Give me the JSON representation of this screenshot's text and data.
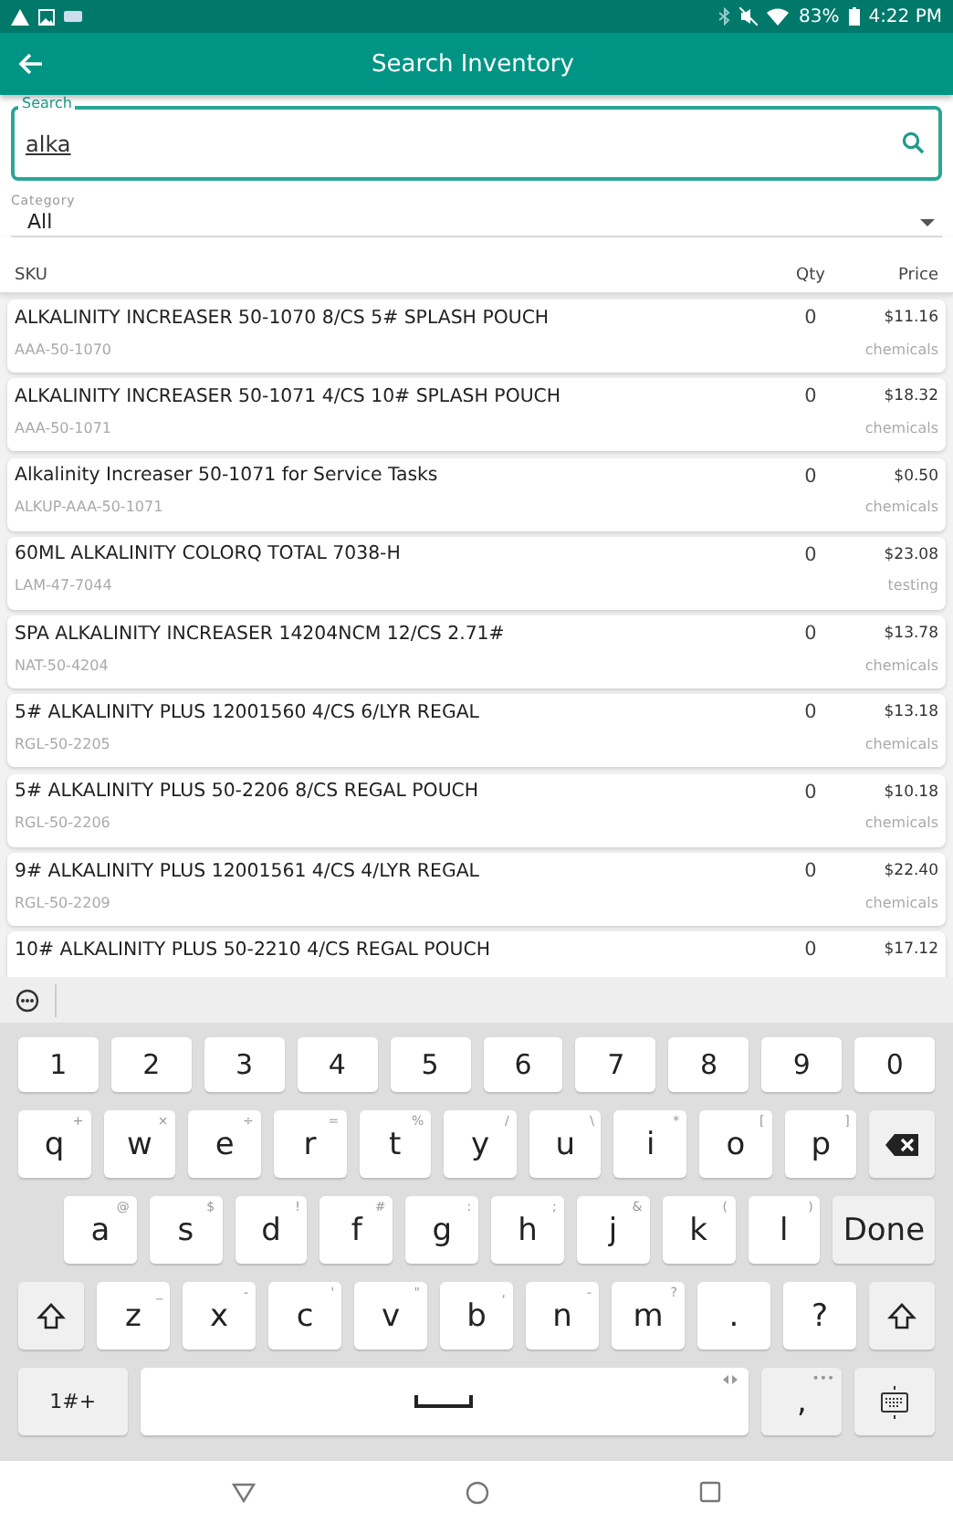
{
  "status_bar": {
    "battery": "83%",
    "time": "4:22 PM"
  },
  "app_bar": {
    "title": "Search Inventory"
  },
  "search": {
    "label": "Search",
    "value": "alka"
  },
  "category": {
    "label": "Category",
    "value": "All"
  },
  "table": {
    "columns": [
      "SKU",
      "Qty",
      "Price"
    ],
    "rows": [
      {
        "name": "ALKALINITY INCREASER 50-1070 8/CS 5# SPLASH POUCH",
        "sku": "AAA-50-1070",
        "qty": "0",
        "price": "$11.16",
        "category": "chemicals"
      },
      {
        "name": "ALKALINITY INCREASER 50-1071 4/CS 10# SPLASH POUCH",
        "sku": "AAA-50-1071",
        "qty": "0",
        "price": "$18.32",
        "category": "chemicals"
      },
      {
        "name": "Alkalinity Increaser 50-1071 for Service Tasks",
        "sku": "ALKUP-AAA-50-1071",
        "qty": "0",
        "price": "$0.50",
        "category": "chemicals"
      },
      {
        "name": "60ML ALKALINITY COLORQ TOTAL 7038-H",
        "sku": "LAM-47-7044",
        "qty": "0",
        "price": "$23.08",
        "category": "testing"
      },
      {
        "name": "SPA ALKALINITY INCREASER 14204NCM 12/CS 2.71#",
        "sku": "NAT-50-4204",
        "qty": "0",
        "price": "$13.78",
        "category": "chemicals"
      },
      {
        "name": "5# ALKALINITY PLUS 12001560 4/CS 6/LYR REGAL",
        "sku": "RGL-50-2205",
        "qty": "0",
        "price": "$13.18",
        "category": "chemicals"
      },
      {
        "name": "5# ALKALINITY PLUS 50-2206 8/CS REGAL POUCH",
        "sku": "RGL-50-2206",
        "qty": "0",
        "price": "$10.18",
        "category": "chemicals"
      },
      {
        "name": "9# ALKALINITY PLUS 12001561 4/CS 4/LYR REGAL",
        "sku": "RGL-50-2209",
        "qty": "0",
        "price": "$22.40",
        "category": "chemicals"
      },
      {
        "name": "10# ALKALINITY PLUS 50-2210 4/CS REGAL POUCH",
        "qty": "0",
        "price": "$17.12"
      }
    ]
  },
  "keyboard": {
    "rows": [
      {
        "kind": "numbers",
        "keys": [
          {
            "kind": "char",
            "label": "1"
          },
          {
            "kind": "char",
            "label": "2"
          },
          {
            "kind": "char",
            "label": "3"
          },
          {
            "kind": "char",
            "label": "4"
          },
          {
            "kind": "char",
            "label": "5"
          },
          {
            "kind": "char",
            "label": "6"
          },
          {
            "kind": "char",
            "label": "7"
          },
          {
            "kind": "char",
            "label": "8"
          },
          {
            "kind": "char",
            "label": "9"
          },
          {
            "kind": "char",
            "label": "0"
          }
        ]
      },
      {
        "kind": "letters",
        "keys": [
          {
            "kind": "char",
            "label": "q",
            "hint": "+"
          },
          {
            "kind": "char",
            "label": "w",
            "hint": "×"
          },
          {
            "kind": "char",
            "label": "e",
            "hint": "÷"
          },
          {
            "kind": "char",
            "label": "r",
            "hint": "="
          },
          {
            "kind": "char",
            "label": "t",
            "hint": "%"
          },
          {
            "kind": "char",
            "label": "y",
            "hint": "/"
          },
          {
            "kind": "char",
            "label": "u",
            "hint": "\\"
          },
          {
            "kind": "char",
            "label": "i",
            "hint": "*"
          },
          {
            "kind": "char",
            "label": "o",
            "hint": "["
          },
          {
            "kind": "char",
            "label": "p",
            "hint": "]"
          },
          {
            "kind": "backspace"
          }
        ]
      },
      {
        "kind": "home",
        "keys": [
          {
            "kind": "char",
            "label": "a",
            "hint": "@"
          },
          {
            "kind": "char",
            "label": "s",
            "hint": "$"
          },
          {
            "kind": "char",
            "label": "d",
            "hint": "!"
          },
          {
            "kind": "char",
            "label": "f",
            "hint": "#"
          },
          {
            "kind": "char",
            "label": "g",
            "hint": ":"
          },
          {
            "kind": "char",
            "label": "h",
            "hint": ";"
          },
          {
            "kind": "char",
            "label": "j",
            "hint": "&"
          },
          {
            "kind": "char",
            "label": "k",
            "hint": "("
          },
          {
            "kind": "char",
            "label": "l",
            "hint": ")"
          },
          {
            "kind": "done",
            "label": "Done"
          }
        ]
      },
      {
        "kind": "letters",
        "keys": [
          {
            "kind": "shift"
          },
          {
            "kind": "char",
            "label": "z",
            "hint": "_"
          },
          {
            "kind": "char",
            "label": "x",
            "hint": "-"
          },
          {
            "kind": "char",
            "label": "c",
            "hint": "'"
          },
          {
            "kind": "char",
            "label": "v",
            "hint": "\""
          },
          {
            "kind": "char",
            "label": "b",
            "hint": ","
          },
          {
            "kind": "char",
            "label": "n",
            "hint": "-"
          },
          {
            "kind": "char",
            "label": "m",
            "hint": "?"
          },
          {
            "kind": "char",
            "label": "."
          },
          {
            "kind": "char",
            "label": "?"
          },
          {
            "kind": "shift"
          }
        ]
      },
      {
        "kind": "function",
        "keys": [
          {
            "kind": "symbols",
            "label": "1#+"
          },
          {
            "kind": "space"
          },
          {
            "kind": "comma",
            "label": ",",
            "hint": "•••"
          },
          {
            "kind": "hide"
          }
        ]
      }
    ]
  }
}
